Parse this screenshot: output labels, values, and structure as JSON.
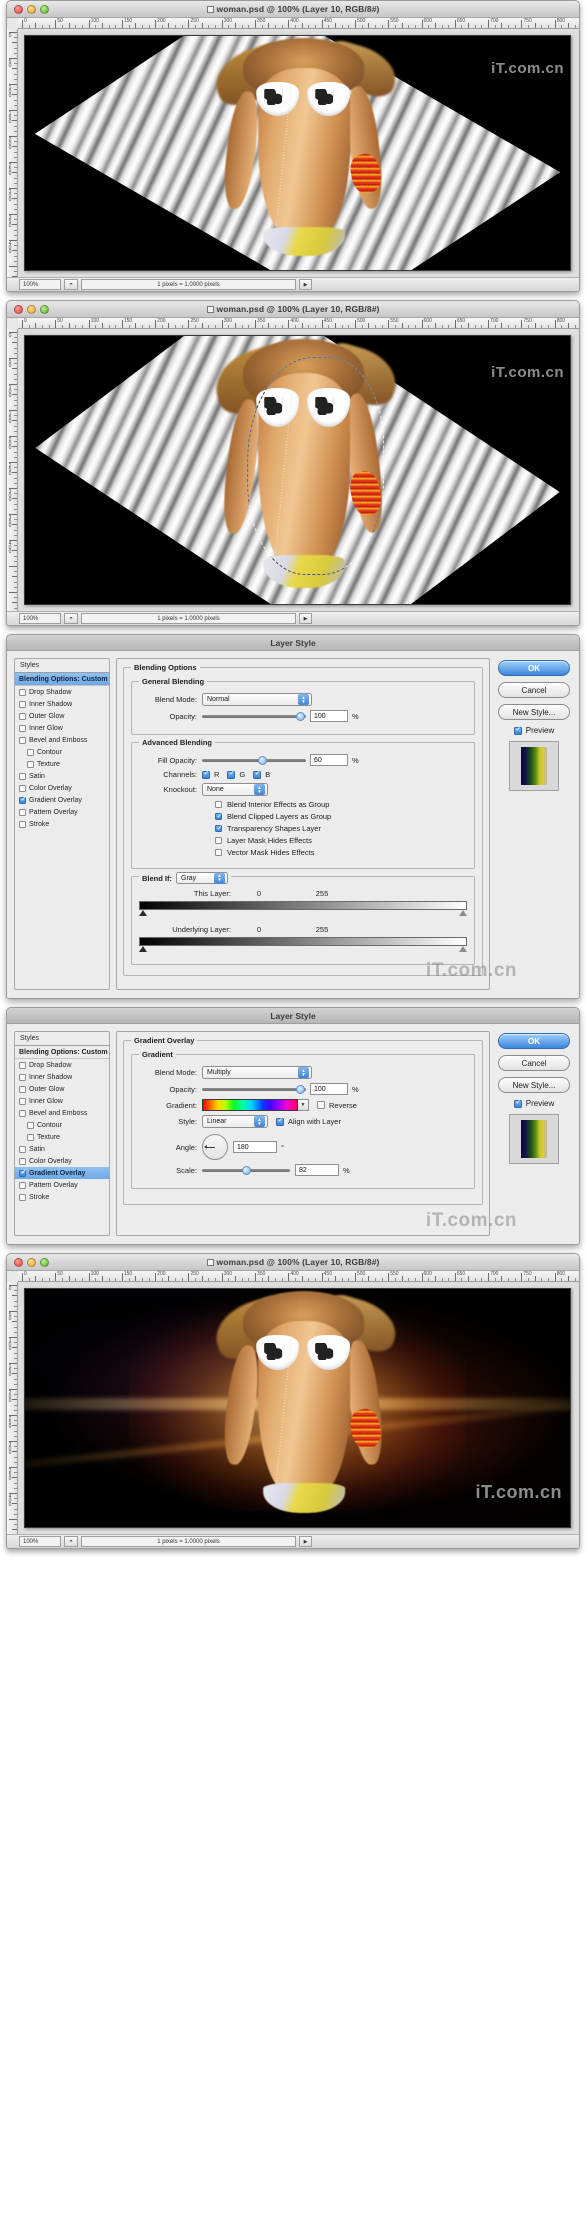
{
  "app": {
    "document_title": "woman.psd @ 100% (Layer 10, RGB/8#)",
    "watermark": "iT.com.cn"
  },
  "window_controls": {
    "close": "close-button",
    "minimize": "minimize-button",
    "zoom": "zoom-button"
  },
  "status_bar": {
    "zoom_level": "100%",
    "info": "1 pixels = 1.0000 pixels",
    "arrow": "▶"
  },
  "ruler": {
    "h_labels": [
      "0",
      "50",
      "100",
      "150",
      "200",
      "250",
      "300",
      "350",
      "400",
      "450",
      "500",
      "550",
      "600",
      "650",
      "700",
      "750",
      "800"
    ],
    "v_labels": [
      "0",
      "50",
      "100",
      "150",
      "200",
      "250",
      "300",
      "350",
      "400"
    ],
    "unit": "pixels"
  },
  "layer_style_1": {
    "title": "Layer Style",
    "styles_header": "Styles",
    "styles_items": [
      {
        "label": "Blending Options: Custom",
        "checked": null,
        "selected": true,
        "indent": false
      },
      {
        "label": "Drop Shadow",
        "checked": false,
        "selected": false,
        "indent": false
      },
      {
        "label": "Inner Shadow",
        "checked": false,
        "selected": false,
        "indent": false
      },
      {
        "label": "Outer Glow",
        "checked": false,
        "selected": false,
        "indent": false
      },
      {
        "label": "Inner Glow",
        "checked": false,
        "selected": false,
        "indent": false
      },
      {
        "label": "Bevel and Emboss",
        "checked": false,
        "selected": false,
        "indent": false
      },
      {
        "label": "Contour",
        "checked": false,
        "selected": false,
        "indent": true
      },
      {
        "label": "Texture",
        "checked": false,
        "selected": false,
        "indent": true
      },
      {
        "label": "Satin",
        "checked": false,
        "selected": false,
        "indent": false
      },
      {
        "label": "Color Overlay",
        "checked": false,
        "selected": false,
        "indent": false
      },
      {
        "label": "Gradient Overlay",
        "checked": true,
        "selected": false,
        "indent": false
      },
      {
        "label": "Pattern Overlay",
        "checked": false,
        "selected": false,
        "indent": false
      },
      {
        "label": "Stroke",
        "checked": false,
        "selected": false,
        "indent": false
      }
    ],
    "panel_legend": "Blending Options",
    "general_blending": {
      "legend": "General Blending",
      "blend_mode_label": "Blend Mode:",
      "blend_mode_value": "Normal",
      "opacity_label": "Opacity:",
      "opacity_value": "100",
      "opacity_unit": "%"
    },
    "advanced_blending": {
      "legend": "Advanced Blending",
      "fill_opacity_label": "Fill Opacity:",
      "fill_opacity_value": "60",
      "fill_opacity_unit": "%",
      "channels_label": "Channels:",
      "channels": [
        {
          "name": "R",
          "checked": true
        },
        {
          "name": "G",
          "checked": true
        },
        {
          "name": "B",
          "checked": true
        }
      ],
      "knockout_label": "Knockout:",
      "knockout_value": "None",
      "options": [
        {
          "label": "Blend Interior Effects as Group",
          "checked": false
        },
        {
          "label": "Blend Clipped Layers as Group",
          "checked": true
        },
        {
          "label": "Transparency Shapes Layer",
          "checked": true
        },
        {
          "label": "Layer Mask Hides Effects",
          "checked": false
        },
        {
          "label": "Vector Mask Hides Effects",
          "checked": false
        }
      ]
    },
    "blend_if": {
      "legend": "Blend If:",
      "channel_value": "Gray",
      "this_layer_label": "This Layer:",
      "this_layer_min": "0",
      "this_layer_max": "255",
      "underlying_label": "Underlying Layer:",
      "underlying_min": "0",
      "underlying_max": "255"
    },
    "buttons": {
      "ok": "OK",
      "cancel": "Cancel",
      "new_style": "New Style...",
      "preview": "Preview"
    }
  },
  "layer_style_2": {
    "title": "Layer Style",
    "styles_header": "Styles",
    "styles_items": [
      {
        "label": "Blending Options: Custom",
        "checked": null,
        "selected": false,
        "indent": false
      },
      {
        "label": "Drop Shadow",
        "checked": false,
        "selected": false,
        "indent": false
      },
      {
        "label": "Inner Shadow",
        "checked": false,
        "selected": false,
        "indent": false
      },
      {
        "label": "Outer Glow",
        "checked": false,
        "selected": false,
        "indent": false
      },
      {
        "label": "Inner Glow",
        "checked": false,
        "selected": false,
        "indent": false
      },
      {
        "label": "Bevel and Emboss",
        "checked": false,
        "selected": false,
        "indent": false
      },
      {
        "label": "Contour",
        "checked": false,
        "selected": false,
        "indent": true
      },
      {
        "label": "Texture",
        "checked": false,
        "selected": false,
        "indent": true
      },
      {
        "label": "Satin",
        "checked": false,
        "selected": false,
        "indent": false
      },
      {
        "label": "Color Overlay",
        "checked": false,
        "selected": false,
        "indent": false
      },
      {
        "label": "Gradient Overlay",
        "checked": true,
        "selected": true,
        "indent": false
      },
      {
        "label": "Pattern Overlay",
        "checked": false,
        "selected": false,
        "indent": false
      },
      {
        "label": "Stroke",
        "checked": false,
        "selected": false,
        "indent": false
      }
    ],
    "panel_legend": "Gradient Overlay",
    "gradient": {
      "legend": "Gradient",
      "blend_mode_label": "Blend Mode:",
      "blend_mode_value": "Multiply",
      "opacity_label": "Opacity:",
      "opacity_value": "100",
      "opacity_unit": "%",
      "gradient_label": "Gradient:",
      "reverse_label": "Reverse",
      "reverse_checked": false,
      "style_label": "Style:",
      "style_value": "Linear",
      "align_label": "Align with Layer",
      "align_checked": true,
      "angle_label": "Angle:",
      "angle_value": "180",
      "angle_unit": "°",
      "scale_label": "Scale:",
      "scale_value": "82",
      "scale_unit": "%"
    },
    "buttons": {
      "ok": "OK",
      "cancel": "Cancel",
      "new_style": "New Style...",
      "preview": "Preview"
    }
  },
  "colors": {
    "accent": "#3d86dc",
    "selection": "#6fa8e6",
    "dialog_bg": "#ececec",
    "window_chrome": "#dcdcdc"
  }
}
